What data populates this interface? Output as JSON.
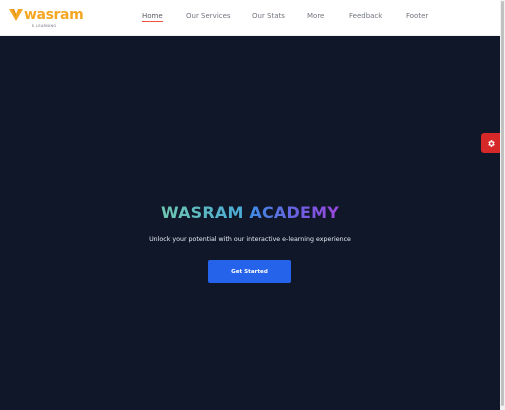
{
  "brand": {
    "name": "wasram",
    "tagline": "E-LEARNING",
    "logo_icon": "wasram-logo-mark",
    "color": "#f5a623"
  },
  "nav": {
    "items": [
      {
        "label": "Home",
        "active": true
      },
      {
        "label": "Our Services",
        "active": false
      },
      {
        "label": "Our Stats",
        "active": false
      },
      {
        "label": "More",
        "active": false
      },
      {
        "label": "Feedback",
        "active": false
      },
      {
        "label": "Footer",
        "active": false
      }
    ],
    "active_underline_color": "#f1533b"
  },
  "hero": {
    "title_part1": "WASRAM",
    "title_part2": "ACADEMY",
    "subtitle": "Unlock your potential with our interactive e-learning experience",
    "cta_label": "Get Started",
    "background_color": "#0f1729",
    "cta_color": "#2563eb"
  },
  "settings": {
    "icon": "gear-icon",
    "color": "#d62828"
  }
}
